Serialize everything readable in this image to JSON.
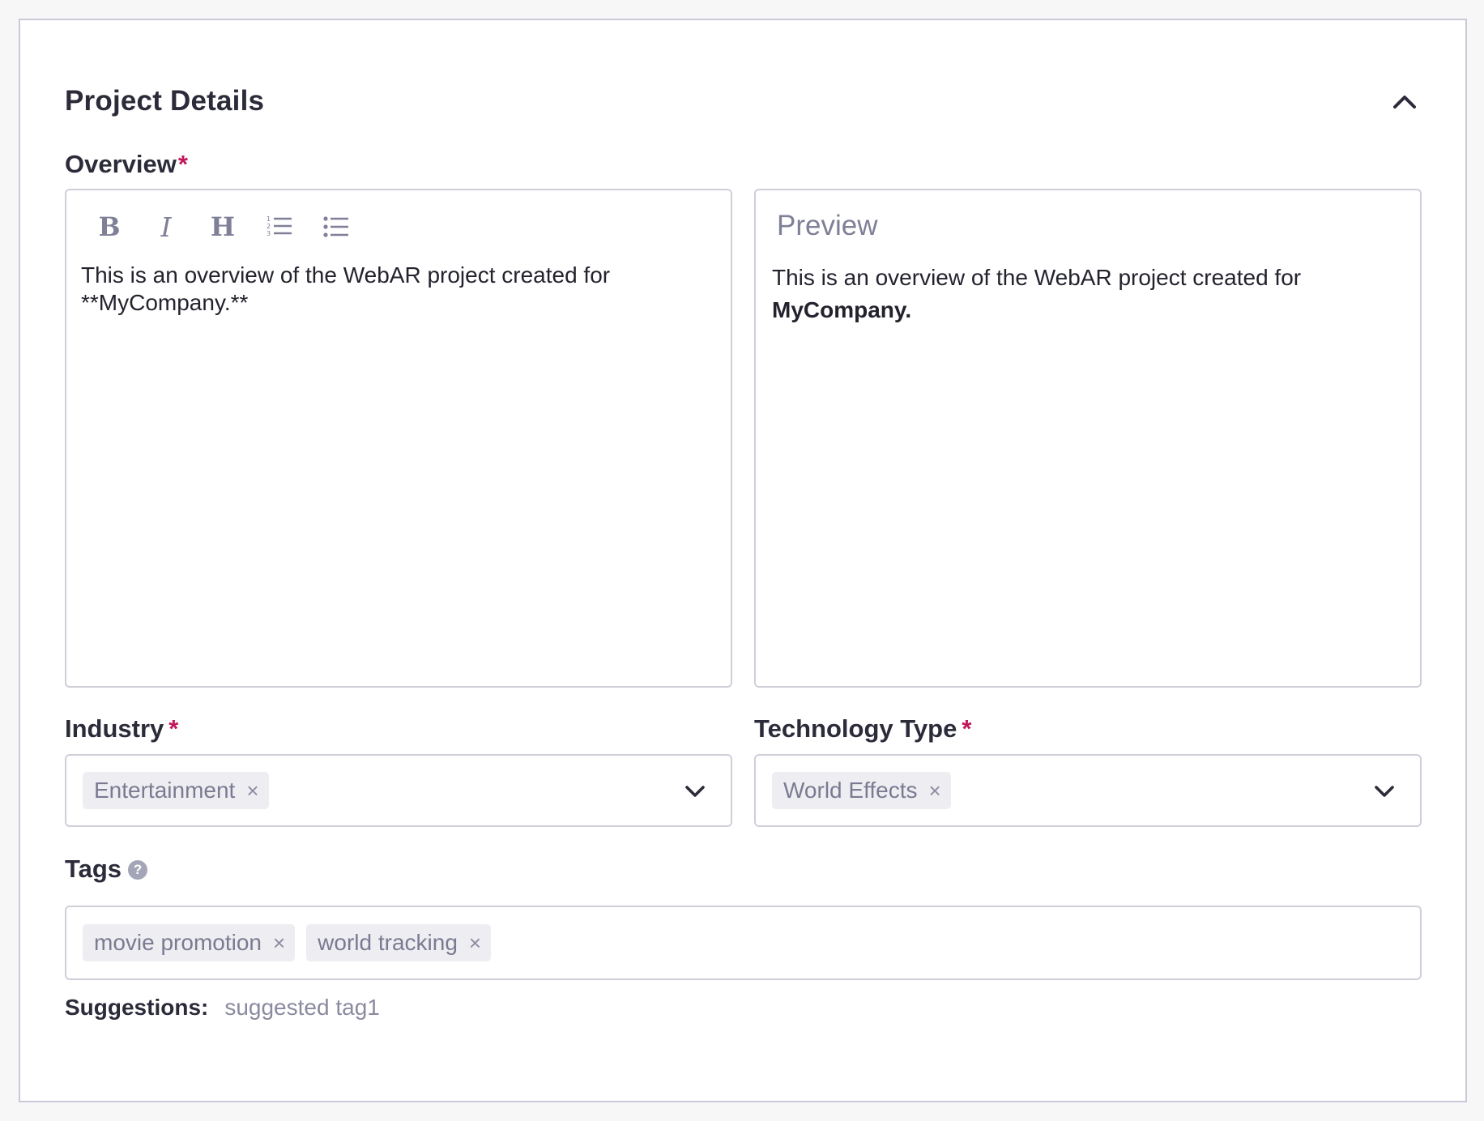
{
  "section": {
    "title": "Project Details"
  },
  "overview": {
    "label": "Overview",
    "required_mark": "*",
    "toolbar": {
      "bold": "B",
      "italic": "I",
      "heading": "H"
    },
    "editor_text": "This is an overview of the WebAR project created for\n**MyCompany.**",
    "preview_title": "Preview",
    "preview_text_plain": "This is an overview of the WebAR project created for",
    "preview_text_bold": "MyCompany."
  },
  "industry": {
    "label": "Industry",
    "required_mark": "*",
    "chips": [
      "Entertainment"
    ]
  },
  "technology": {
    "label": "Technology Type",
    "required_mark": "*",
    "chips": [
      "World Effects"
    ]
  },
  "tags": {
    "label": "Tags",
    "help_glyph": "?",
    "chips": [
      "movie promotion",
      "world tracking"
    ]
  },
  "suggestions": {
    "label": "Suggestions:",
    "items": [
      "suggested tag1"
    ]
  },
  "remove_glyph": "×",
  "colors": {
    "required": "#c2185b",
    "chip_bg": "#eeeef2",
    "muted_text": "#7f7f98"
  }
}
